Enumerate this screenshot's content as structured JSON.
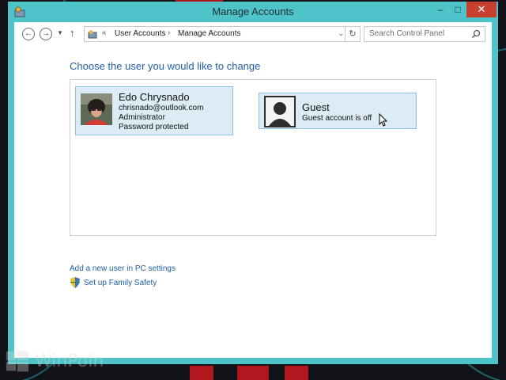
{
  "window": {
    "title": "Manage Accounts",
    "minimize_glyph": "‒",
    "maximize_glyph": "□",
    "close_glyph": "✕",
    "accent": "#4ec4c9"
  },
  "nav": {
    "back_glyph": "←",
    "forward_glyph": "→",
    "recent_glyph": "▼",
    "up_glyph": "↑"
  },
  "address": {
    "overflow_glyph": "«",
    "crumbs": [
      "User Accounts",
      "Manage Accounts"
    ],
    "separator": "›",
    "dropdown_glyph": "⌄",
    "refresh_glyph": "↻"
  },
  "search": {
    "placeholder": "Search Control Panel",
    "icon": "search-icon"
  },
  "main": {
    "heading": "Choose the user you would like to change",
    "accounts": [
      {
        "name": "Edo Chrysnado",
        "email": "chrisnado@outlook.com",
        "role": "Administrator",
        "status": "Password protected"
      },
      {
        "name": "Guest",
        "status": "Guest account is off"
      }
    ],
    "links": {
      "add_user": "Add a new user in PC settings",
      "family_safety": "Set up Family Safety"
    }
  },
  "watermark": {
    "text": "WinPoin"
  },
  "colors": {
    "link": "#1f5fa3",
    "tile_bg": "#dcecf7",
    "tile_border": "#8fbfe3",
    "close_red": "#c7402f"
  }
}
